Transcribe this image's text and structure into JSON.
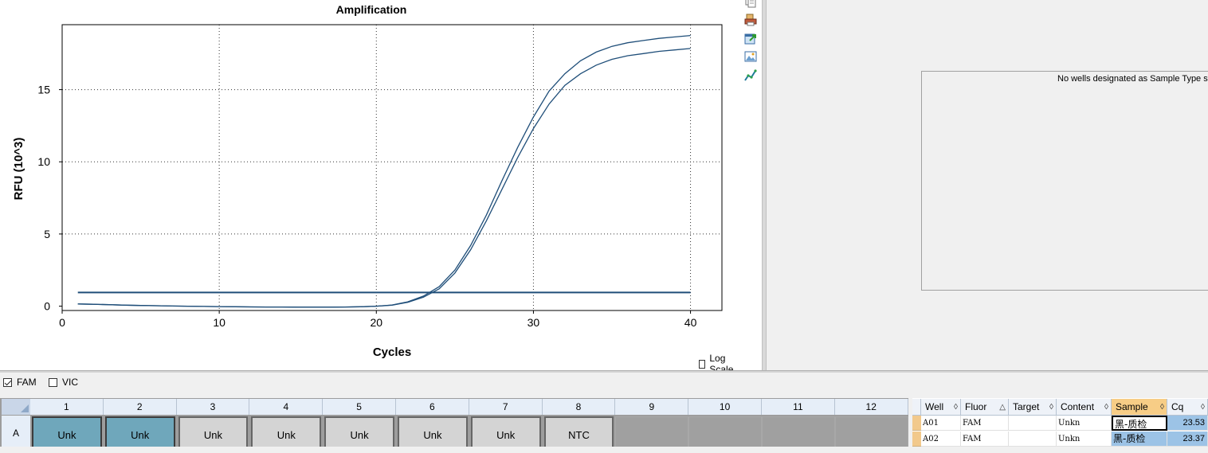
{
  "chart": {
    "title": "Amplification",
    "xlabel": "Cycles",
    "ylabel": "RFU (10^3)",
    "x_ticks": [
      "0",
      "10",
      "20",
      "30",
      "40"
    ],
    "y_ticks": [
      "0",
      "5",
      "10",
      "15"
    ],
    "log_scale_label": "Log Scale",
    "log_scale_checked": false
  },
  "chart_data": {
    "type": "line",
    "title": "Amplification",
    "xlabel": "Cycles",
    "ylabel": "RFU (10^3)",
    "xlim": [
      0,
      42
    ],
    "ylim": [
      -0.3,
      19.5
    ],
    "grid": true,
    "threshold": 0.95,
    "x": [
      1,
      2,
      3,
      4,
      5,
      6,
      7,
      8,
      9,
      10,
      11,
      12,
      13,
      14,
      15,
      16,
      17,
      18,
      19,
      20,
      21,
      22,
      23,
      24,
      25,
      26,
      27,
      28,
      29,
      30,
      31,
      32,
      33,
      34,
      35,
      36,
      37,
      38,
      39,
      40
    ],
    "series": [
      {
        "color": "#1f4e79",
        "values": [
          0.15,
          0.13,
          0.1,
          0.07,
          0.05,
          0.03,
          0.01,
          0.0,
          -0.02,
          -0.03,
          -0.04,
          -0.05,
          -0.06,
          -0.06,
          -0.07,
          -0.07,
          -0.07,
          -0.06,
          -0.04,
          0.0,
          0.08,
          0.3,
          0.7,
          1.35,
          2.5,
          4.2,
          6.3,
          8.7,
          11.0,
          13.1,
          14.9,
          16.1,
          17.0,
          17.6,
          18.0,
          18.25,
          18.4,
          18.55,
          18.65,
          18.75
        ]
      },
      {
        "color": "#1f4e79",
        "values": [
          0.15,
          0.13,
          0.1,
          0.07,
          0.05,
          0.03,
          0.01,
          0.0,
          -0.02,
          -0.03,
          -0.04,
          -0.05,
          -0.06,
          -0.06,
          -0.07,
          -0.07,
          -0.07,
          -0.06,
          -0.04,
          0.0,
          0.07,
          0.27,
          0.62,
          1.2,
          2.3,
          3.9,
          5.9,
          8.1,
          10.3,
          12.3,
          14.0,
          15.3,
          16.1,
          16.7,
          17.1,
          17.35,
          17.5,
          17.65,
          17.75,
          17.85
        ]
      }
    ]
  },
  "toolbar": {
    "icons": [
      "copy-icon",
      "print-icon",
      "export-icon",
      "image-icon",
      "chart-options-icon"
    ]
  },
  "sample_panel": {
    "message": "No wells designated as Sample Type sta"
  },
  "fluors": [
    {
      "label": "FAM",
      "checked": true
    },
    {
      "label": "VIC",
      "checked": false
    }
  ],
  "plate": {
    "columns": [
      "1",
      "2",
      "3",
      "4",
      "5",
      "6",
      "7",
      "8",
      "9",
      "10",
      "11",
      "12"
    ],
    "row_label": "A",
    "wells": [
      "Unk",
      "Unk",
      "Unk",
      "Unk",
      "Unk",
      "Unk",
      "Unk",
      "NTC",
      "",
      "",
      "",
      ""
    ]
  },
  "table": {
    "headers": [
      "Well",
      "Fluor",
      "Target",
      "Content",
      "Sample",
      "Cq"
    ],
    "rows": [
      {
        "well": "A01",
        "fluor": "FAM",
        "target": "",
        "content": "Unkn",
        "sample": "黑-质检",
        "cq": "23.53"
      },
      {
        "well": "A02",
        "fluor": "FAM",
        "target": "",
        "content": "Unkn",
        "sample": "黑-质检",
        "cq": "23.37"
      }
    ]
  }
}
